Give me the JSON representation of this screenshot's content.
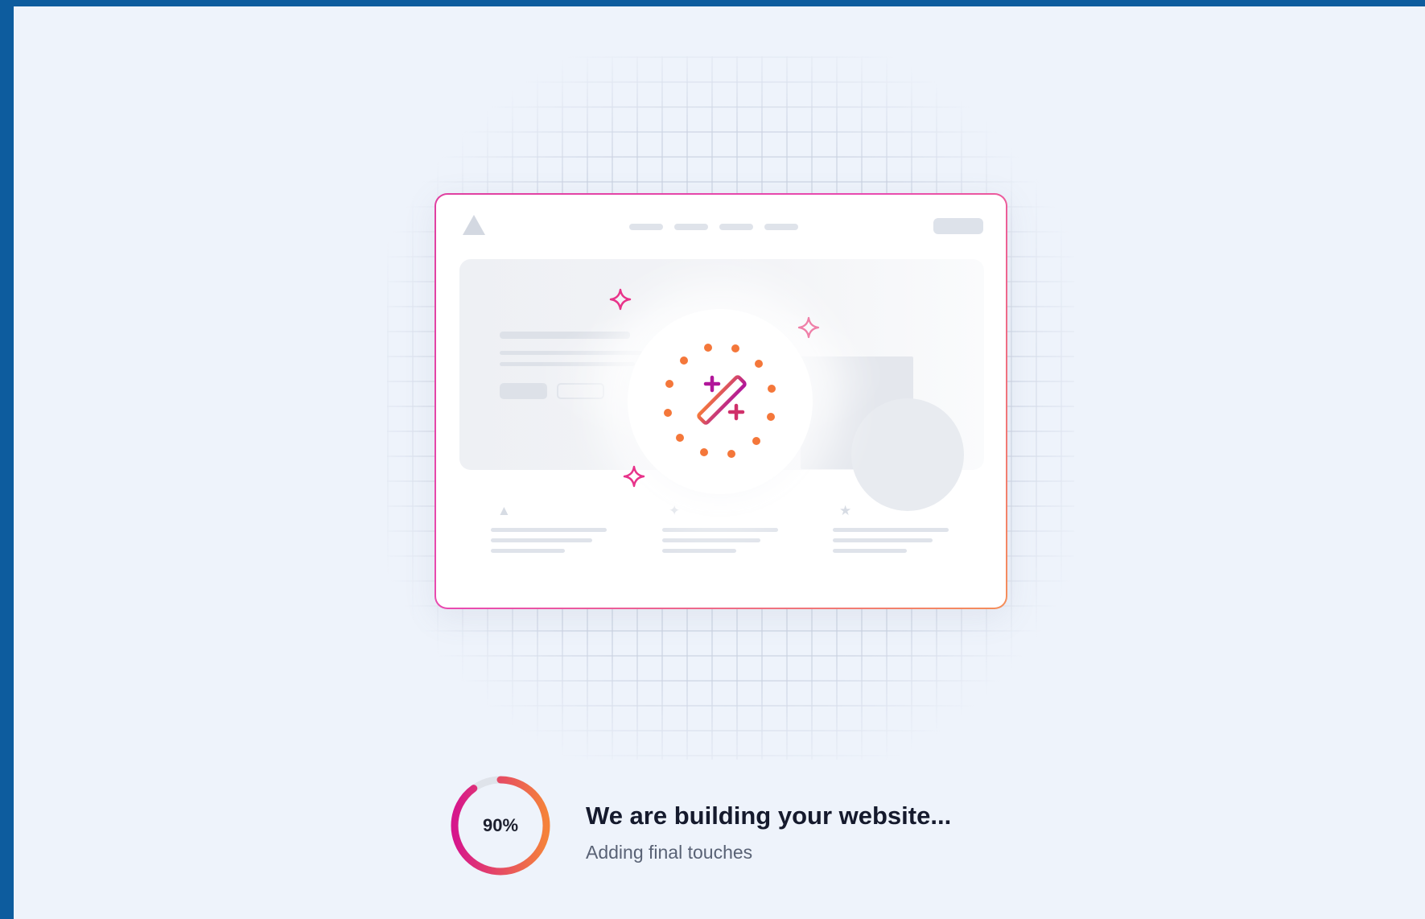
{
  "colors": {
    "frame_bg": "#0d5c9e",
    "page_bg": "#eef3fb",
    "accent_magenta": "#d6168c",
    "accent_orange": "#f5783c",
    "title_text": "#151a2d",
    "subtitle_text": "#596275"
  },
  "illustration": {
    "icons": [
      "magic-wand-icon",
      "sparkle-icon",
      "triangle-logo-icon",
      "diamond-icon",
      "star-icon"
    ]
  },
  "progress": {
    "percent_value": 0.9,
    "percent_label": "90%"
  },
  "status": {
    "title": "We are building your website...",
    "subtitle": "Adding final touches"
  }
}
